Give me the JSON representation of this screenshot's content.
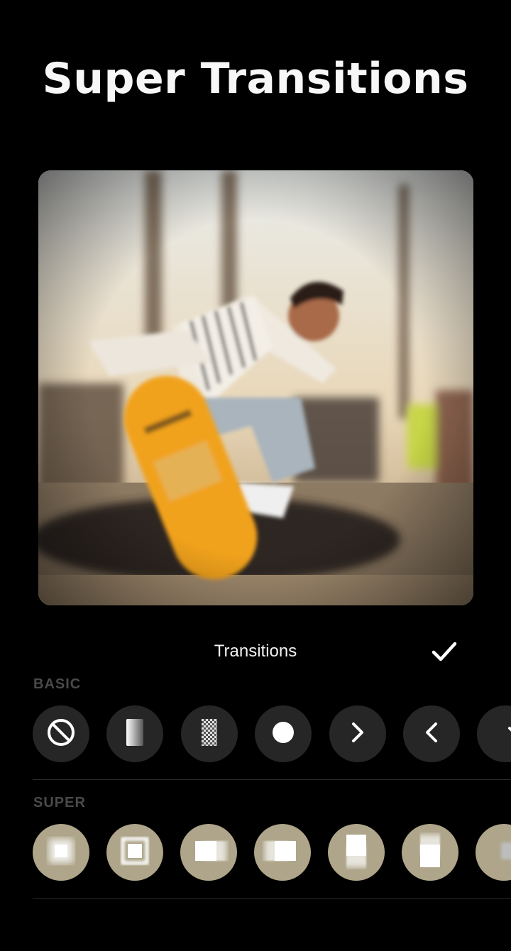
{
  "header": {
    "title": "Super Transitions"
  },
  "panel": {
    "title": "Transitions",
    "confirm_icon": "checkmark-icon"
  },
  "sections": {
    "basic": {
      "label": "BASIC",
      "items": [
        "none-icon",
        "fade-gradient-icon",
        "dissolve-checker-icon",
        "circle-icon",
        "slide-right-chevron-icon",
        "slide-left-chevron-icon",
        "slide-down-chevron-icon"
      ]
    },
    "super": {
      "label": "SUPER",
      "items": [
        "zoom-blur-icon",
        "zoom-frame-icon",
        "spin-blur-left-icon",
        "spin-blur-right-icon",
        "blur-up-icon",
        "blur-down-icon",
        "glitch-icon"
      ]
    }
  },
  "colors": {
    "background": "#000000",
    "basic_button": "#262626",
    "super_button": "#aea58a",
    "section_label": "#4a4a4a"
  }
}
